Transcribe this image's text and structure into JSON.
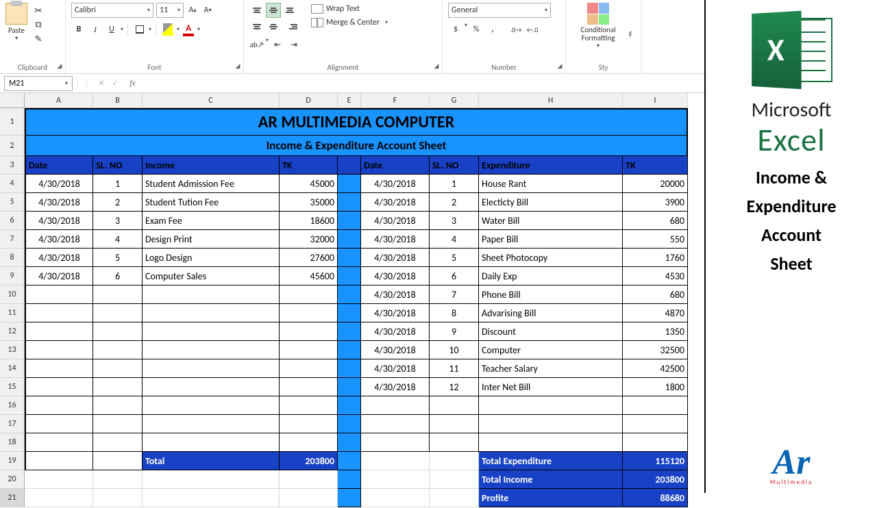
{
  "ribbon": {
    "paste": "Paste",
    "clipboard": "Clipboard",
    "font": "Font",
    "font_name": "Calibri",
    "font_size": "11",
    "alignment": "Alignment",
    "wrap": "Wrap Text",
    "merge": "Merge & Center",
    "number": "Number",
    "num_format": "General",
    "cond": "Conditional Formatting",
    "styles": "Sty",
    "format": "F"
  },
  "fbar": {
    "cell": "M21",
    "fx": "fx"
  },
  "cols": [
    "A",
    "B",
    "C",
    "D",
    "E",
    "F",
    "G",
    "H",
    "I"
  ],
  "rows": [
    "1",
    "2",
    "3",
    "4",
    "5",
    "6",
    "7",
    "8",
    "9",
    "10",
    "11",
    "12",
    "13",
    "14",
    "15",
    "16",
    "17",
    "18",
    "19",
    "20",
    "21"
  ],
  "sheet": {
    "title": "AR MULTIMEDIA COMPUTER",
    "subtitle": "Income & Expenditure Account Sheet",
    "headers": {
      "date1": "Date",
      "sl1": "SL. NO",
      "income": "Income",
      "tk1": "TK",
      "date2": "Date",
      "sl2": "SL. NO",
      "exp": "Expenditure",
      "tk2": "TK"
    },
    "income": [
      {
        "d": "4/30/2018",
        "s": "1",
        "n": "Student Admission Fee",
        "t": "45000"
      },
      {
        "d": "4/30/2018",
        "s": "2",
        "n": "Student Tution Fee",
        "t": "35000"
      },
      {
        "d": "4/30/2018",
        "s": "3",
        "n": "Exam Fee",
        "t": "18600"
      },
      {
        "d": "4/30/2018",
        "s": "4",
        "n": "Design Print",
        "t": "32000"
      },
      {
        "d": "4/30/2018",
        "s": "5",
        "n": "Logo Design",
        "t": "27600"
      },
      {
        "d": "4/30/2018",
        "s": "6",
        "n": "Computer Sales",
        "t": "45600"
      }
    ],
    "expense": [
      {
        "d": "4/30/2018",
        "s": "1",
        "n": "House Rant",
        "t": "20000"
      },
      {
        "d": "4/30/2018",
        "s": "2",
        "n": "Electicty Bill",
        "t": "3900"
      },
      {
        "d": "4/30/2018",
        "s": "3",
        "n": "Water Bill",
        "t": "680"
      },
      {
        "d": "4/30/2018",
        "s": "4",
        "n": "Paper Bill",
        "t": "550"
      },
      {
        "d": "4/30/2018",
        "s": "5",
        "n": "Sheet Photocopy",
        "t": "1760"
      },
      {
        "d": "4/30/2018",
        "s": "6",
        "n": "Daily Exp",
        "t": "4530"
      },
      {
        "d": "4/30/2018",
        "s": "7",
        "n": "Phone Bill",
        "t": "680"
      },
      {
        "d": "4/30/2018",
        "s": "8",
        "n": "Advarising Bill",
        "t": "4870"
      },
      {
        "d": "4/30/2018",
        "s": "9",
        "n": "Discount",
        "t": "1350"
      },
      {
        "d": "4/30/2018",
        "s": "10",
        "n": "Computer",
        "t": "32500"
      },
      {
        "d": "4/30/2018",
        "s": "11",
        "n": "Teacher Salary",
        "t": "42500"
      },
      {
        "d": "4/30/2018",
        "s": "12",
        "n": "Inter Net Bill",
        "t": "1800"
      }
    ],
    "total_label": "Total",
    "total_income": "203800",
    "summary": [
      {
        "l": "Total Expenditure",
        "v": "115120"
      },
      {
        "l": "Total Income",
        "v": "203800"
      },
      {
        "l": "Profite",
        "v": "88680"
      }
    ]
  },
  "side": {
    "ms": "Microsoft",
    "excel": "Excel",
    "l1": "Income &",
    "l2": "Expenditure",
    "l3": "Account",
    "l4": "Sheet",
    "logo": "Ar",
    "sub": "Multimedia"
  }
}
